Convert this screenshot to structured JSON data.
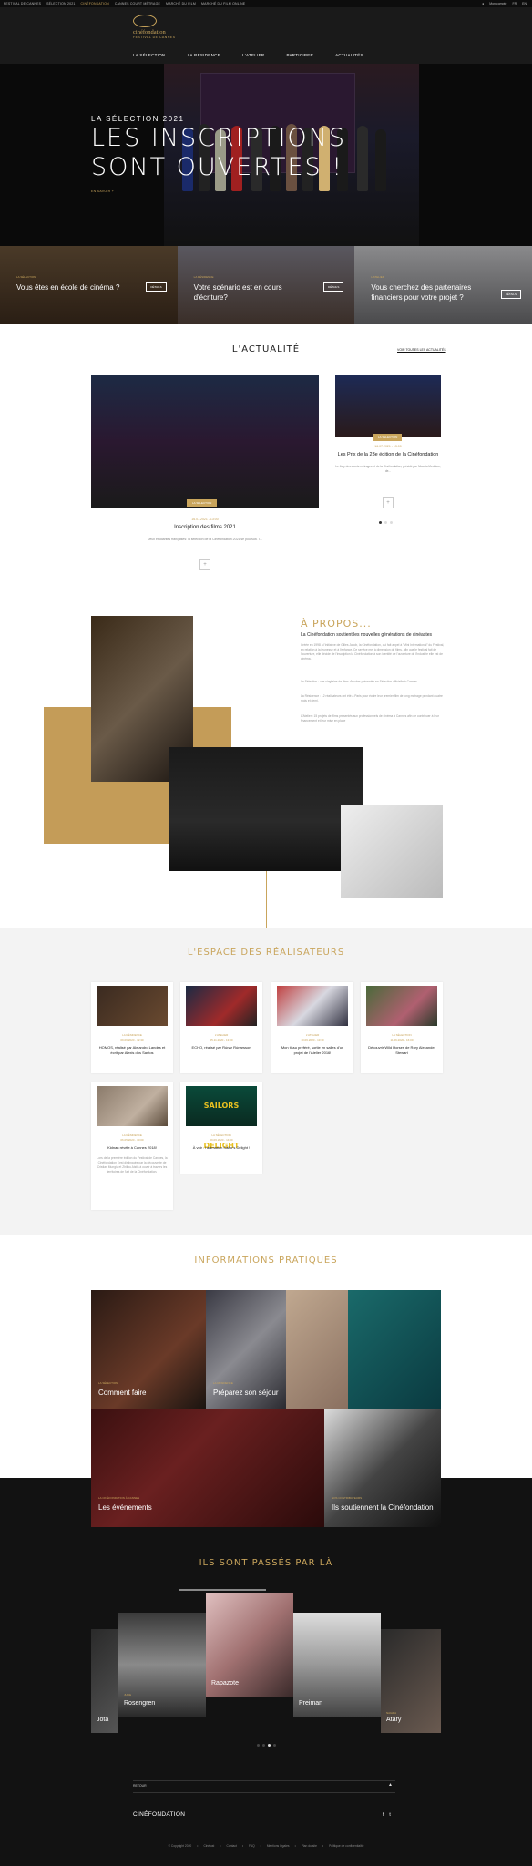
{
  "topbar": {
    "links": [
      "FESTIVAL DE CANNES",
      "SÉLECTION 2021",
      "CINÉFONDATION",
      "CANNES COURT MÉTRAGE",
      "MARCHÉ DU FILM",
      "MARCHÉ DU FILM ONLINE"
    ],
    "active_index": 2,
    "account": "Mon compte",
    "lang": "FR",
    "lang_alt": "EN"
  },
  "header": {
    "logo_line1": "cinéfondation",
    "logo_line2": "FESTIVAL DE CANNES",
    "nav": [
      "LA SÉLECTION",
      "LA RÉSIDENCE",
      "L'ATELIER",
      "PARTICIPER",
      "ACTUALITÉS"
    ]
  },
  "hero": {
    "kicker": "LA SÉLECTION 2021",
    "title_line1": "LES INSCRIPTIONS",
    "title_line2": "SONT OUVERTES !",
    "more": "EN SAVOIR +"
  },
  "promo_cards": [
    {
      "kicker": "LA SÉLECTION",
      "text": "Vous êtes en école de cinéma ?",
      "button": "DÉTAILS"
    },
    {
      "kicker": "LA RÉSIDENCE",
      "text": "Votre scénario est en cours d'écriture?",
      "button": "DÉTAILS"
    },
    {
      "kicker": "L'ATELIER",
      "text": "Vous cherchez des partenaires financiers pour votre projet ?",
      "button": "DÉTAILS"
    }
  ],
  "actualite": {
    "title": "L'ACTUALITÉ",
    "link": "VOIR TOUTES LES ACTUALITÉS",
    "big": {
      "badge": "LA SÉLECTION",
      "date": "16.07.2021 - 13:00",
      "headline": "Inscription des films 2021",
      "text": "Deux étudiantes françaises: la sélection de la Cinéfondation 2021 se poursuit. T..."
    },
    "small": {
      "badge": "LA SÉLECTION",
      "date": "16.07.2021 - 13:00",
      "headline": "Les Prix de la 23e édition de la Cinéfondation",
      "text": "Le Jury des courts métrages et de la Cinéfondation, présidé par Mounia Meddour, de..."
    },
    "plus": "+"
  },
  "apropos": {
    "title": "À PROPOS...",
    "headline": "La Cinéfondation soutient les nouvelles générations de cinéastes",
    "p1": "Créée en 1998 à l'initiative de Gilles Jacob, la Cinéfondation, qui fait appel à \"Mini International\" du Festival, en relation à la jeunesse et à l'enfance. Ce service met à dimension de films, afin que le festival fait de l'ouverture, elle décide de l'inscription la Cinéfondation à son identité de l'ouverture de l'industrie elle est de cinéma.",
    "p2": "La Sélection : une vingtaine de films d'écoles présentés en Sélection officielle à Cannes.",
    "p3": "La Résidence : 12 réalisateurs ont été à Paris pour écrire leur premier film de long métrage pendant quatre mois et demi.",
    "p4": "L'Atelier : 15 projets de films présentés aux professionnels de cinéma à Cannes afin de contribuer à leur financement et leur mise en place"
  },
  "espace": {
    "title": "L'ESPACE DES RÉALISATEURS",
    "cards": [
      {
        "kicker": "LA RÉSIDENCE",
        "date": "09.06.2020 - 12:30",
        "title": "HOMOS, réalisé par Alejandro Landes et écrit par Alexis dos Santos",
        "text": ""
      },
      {
        "kicker": "L'ATELIER",
        "date": "05.11.2020 - 13:00",
        "title": "ECHO, réalisé par Rúnar Rúnarsson",
        "text": ""
      },
      {
        "kicker": "L'ATELIER",
        "date": "10.06.2020 - 13:30",
        "title": "Mon tissu préféré, sortie en salles d'un projet de l'Atelier 2016!",
        "text": ""
      },
      {
        "kicker": "LA SÉLECTION",
        "date": "11.06.2020 - 16:00",
        "title": "Découvrir Wild Horses de Rory Alexander Stewart",
        "text": ""
      },
      {
        "kicker": "LA RÉSIDENCE",
        "date": "06.05.2020 - 10:00",
        "title": "Kidnan révèle à Cannes 2018!",
        "text": "Lors de la première édition du Festival de Cannes, la Cinéfondation s'est distinguée par la découverte de Cristian Mungiu et Zhiliou Aistis à ouvrir à travers les territoires de l'art de la Cinéfondation."
      },
      {
        "kicker": "LA SÉLECTION",
        "date": "09.06.2020 - 14:00",
        "title": "À voir : l'animation Sailor's Delight !",
        "text": ""
      }
    ],
    "poster_text": "SAILORS DELIGHT"
  },
  "infos": {
    "title": "INFORMATIONS PRATIQUES",
    "tiles": [
      {
        "kicker": "LA SÉLECTION",
        "title": "Comment faire"
      },
      {
        "kicker": "LA RÉSIDENCE",
        "title": "Préparez son séjour"
      },
      {
        "kicker": "LA CINÉFONDATION À CANNES",
        "title": "Les événements"
      },
      {
        "kicker": "NOS CONTRIBUTEURS",
        "title": "Ils soutiennent la Cinéfondation"
      }
    ]
  },
  "passes": {
    "title": "ILS SONT PASSÉS PAR LÀ",
    "people": [
      {
        "kicker": "",
        "name": "Jota"
      },
      {
        "kicker": "JULIE",
        "name": "Rosengren"
      },
      {
        "kicker": "",
        "name": "Rapazote"
      },
      {
        "kicker": "",
        "name": "Preiman"
      },
      {
        "kicker": "NAIARA",
        "name": "Atary"
      }
    ]
  },
  "footer": {
    "retour": "RETOUR",
    "up": "▲",
    "brand": "CINÉFONDATION",
    "social": [
      "f",
      "t"
    ],
    "links": [
      "© Copyright 2020",
      "Cinéjust",
      "Contact",
      "FAQ",
      "Mentions légales",
      "Plan du site",
      "Politique de confidentialité"
    ]
  },
  "colors": {
    "gold": "#c9a55c",
    "dark": "#121212"
  }
}
